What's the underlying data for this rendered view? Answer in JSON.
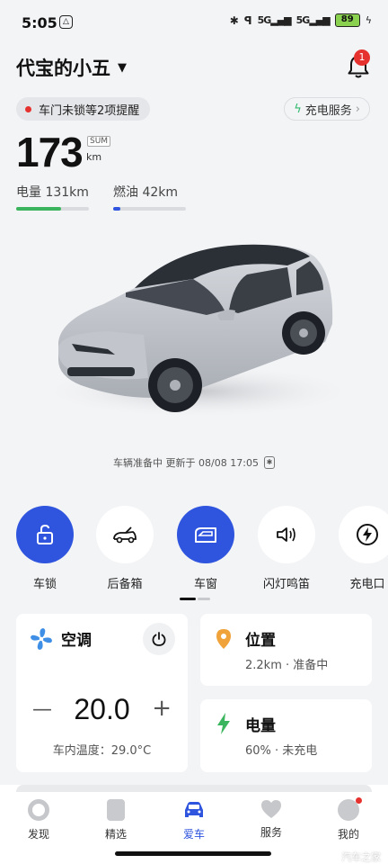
{
  "status_bar": {
    "time": "5:05",
    "signal1": "5G",
    "signal2": "5G",
    "battery": "89"
  },
  "header": {
    "car_name": "代宝的小五",
    "notification_count": "1"
  },
  "alert": {
    "text": "车门未锁等2项提醒"
  },
  "charge_service": {
    "label": "充电服务"
  },
  "range": {
    "value": "173",
    "tag": "SUM",
    "unit": "km"
  },
  "electric": {
    "label": "电量 131km",
    "level": 0.62
  },
  "fuel": {
    "label": "燃油 42km",
    "level": 0.1
  },
  "update_text": "车辆准备中 更新于 08/08 17:05",
  "controls": [
    {
      "label": "车锁",
      "icon": "unlock-icon",
      "active": true
    },
    {
      "label": "后备箱",
      "icon": "trunk-icon",
      "active": false
    },
    {
      "label": "车窗",
      "icon": "window-icon",
      "active": true
    },
    {
      "label": "闪灯鸣笛",
      "icon": "horn-icon",
      "active": false
    },
    {
      "label": "充电口",
      "icon": "charge-port-icon",
      "active": false
    }
  ],
  "climate": {
    "title": "空调",
    "temp": "20.0",
    "inside_temp": "车内温度：29.0°C"
  },
  "location": {
    "title": "位置",
    "sub": "2.2km · 准备中"
  },
  "battery_card": {
    "title": "电量",
    "sub": "60% · 未充电"
  },
  "nav": [
    {
      "label": "发现",
      "active": false
    },
    {
      "label": "精选",
      "active": false
    },
    {
      "label": "爱车",
      "active": true
    },
    {
      "label": "服务",
      "active": false
    },
    {
      "label": "我的",
      "active": false
    }
  ],
  "watermark": "汽车之家",
  "colors": {
    "accent": "#2f55df",
    "green": "#3bb55d",
    "red": "#e6322e",
    "fuel_blue": "#2f55df"
  }
}
